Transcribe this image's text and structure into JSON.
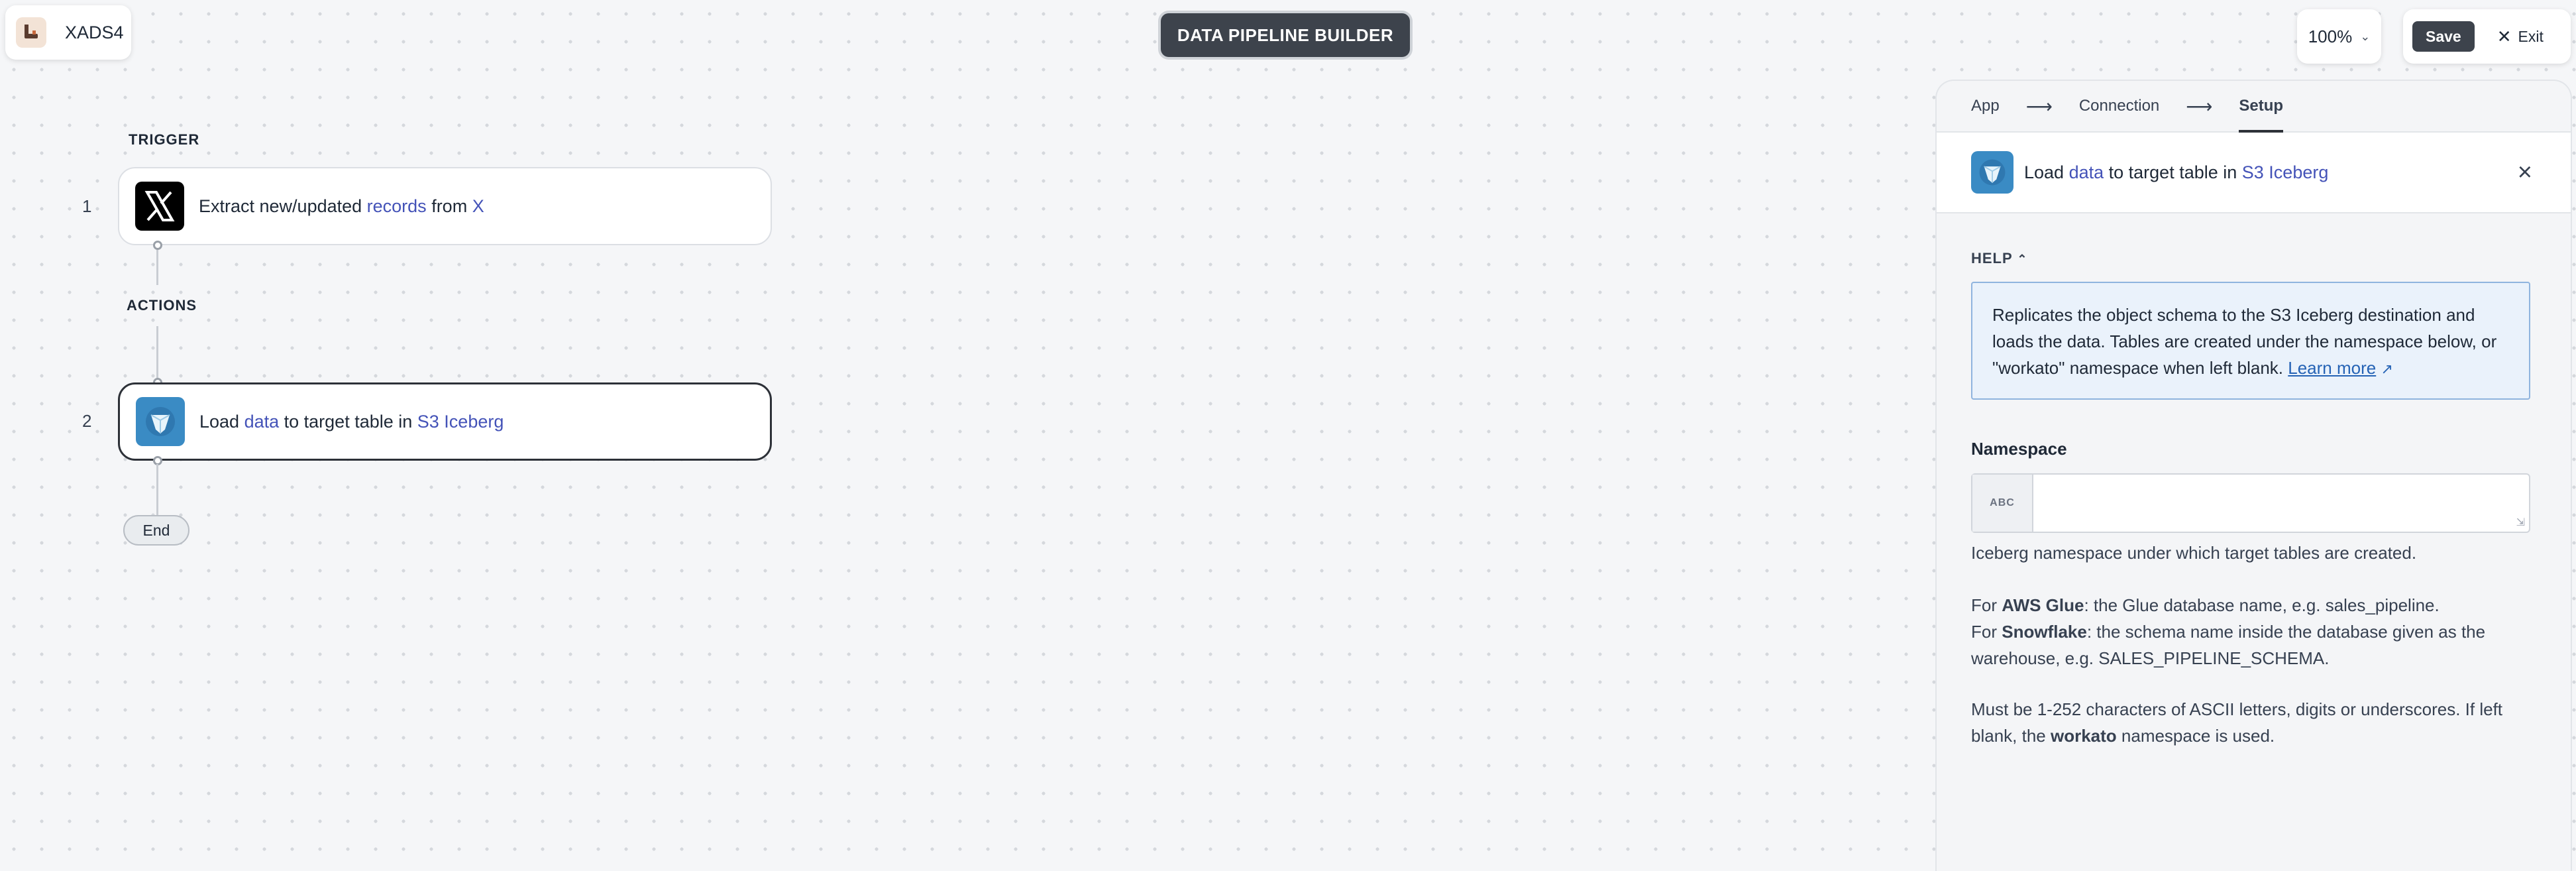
{
  "workspace": {
    "name": "XADS4"
  },
  "header": {
    "title": "DATA PIPELINE BUILDER",
    "zoom": "100%",
    "save_label": "Save",
    "exit_label": "Exit"
  },
  "canvas": {
    "trigger_label": "TRIGGER",
    "actions_label": "ACTIONS",
    "steps": [
      {
        "num": "1",
        "prefix": "Extract new/updated ",
        "obj": "records",
        "mid": " from ",
        "app": "X",
        "icon": "x-logo-icon"
      },
      {
        "num": "2",
        "prefix": "Load ",
        "obj": "data",
        "mid": " to target table in ",
        "app": "S3 Iceberg",
        "icon": "s3-iceberg-icon"
      }
    ],
    "end_label": "End"
  },
  "panel": {
    "tabs": [
      "App",
      "Connection",
      "Setup"
    ],
    "header": {
      "prefix": "Load ",
      "obj": "data",
      "mid": " to target table in ",
      "app": "S3 Iceberg"
    },
    "help_label": "HELP",
    "help_text": "Replicates the object schema to the S3 Iceberg destination and loads the data. Tables are created under the namespace below, or \"workato\" namespace when left blank.",
    "help_link": "Learn more",
    "field_label": "Namespace",
    "field_badge": "ABC",
    "field_value": "",
    "hint1": "Iceberg namespace under which target tables are created.",
    "hint2_prefix": "For ",
    "hint2_bold": "AWS Glue",
    "hint2_rest": ": the Glue database name, e.g. sales_pipeline.",
    "hint3_prefix": "For ",
    "hint3_bold": "Snowflake",
    "hint3_rest": ": the schema name inside the database given as the warehouse, e.g. SALES_PIPELINE_SCHEMA.",
    "hint4_prefix": "Must be 1-252 characters of ASCII letters, digits or underscores. If left blank, the ",
    "hint4_bold": "workato",
    "hint4_rest": " namespace is used."
  }
}
